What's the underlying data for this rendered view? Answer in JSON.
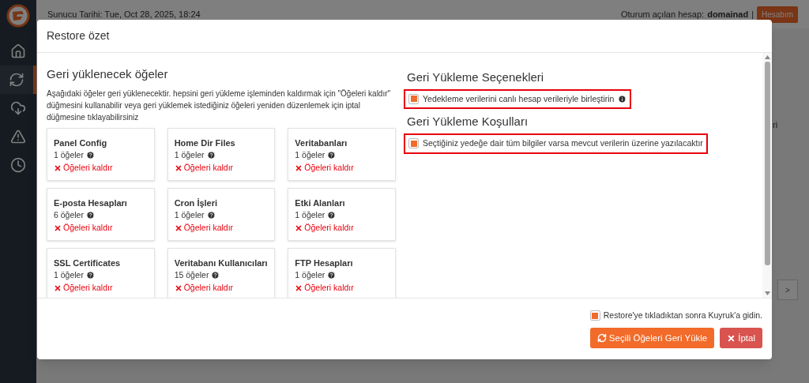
{
  "header": {
    "date_label": "Sunucu Tarihi: Tue, Oct 28, 2025, 18:24",
    "login_label": "Oturum açılan hesap:",
    "username": "domainad",
    "separator": "|",
    "account_button": "Hesabım"
  },
  "sidebar": {
    "items": [
      {
        "kind": "home",
        "selected": false
      },
      {
        "kind": "refresh",
        "selected": true
      },
      {
        "kind": "download",
        "selected": false
      },
      {
        "kind": "warning",
        "selected": false
      },
      {
        "kind": "clock",
        "selected": false
      }
    ]
  },
  "background_fragments": [
    "ri",
    ">"
  ],
  "modal": {
    "title": "Restore özet",
    "items_heading": "Geri yüklenecek öğeler",
    "description": "Aşağıdaki öğeler geri yüklenecektir. hepsini geri yükleme işleminden kaldırmak için \"Öğeleri kaldır\" düğmesini kullanabilir veya geri yüklemek istediğiniz öğeleri yeniden düzenlemek için iptal düğmesine tıklayabilirsiniz",
    "items": [
      {
        "name": "Panel Config",
        "count": "1 öğeler",
        "remove": "Öğeleri kaldır"
      },
      {
        "name": "Home Dir Files",
        "count": "1 öğeler",
        "remove": "Öğeleri kaldır"
      },
      {
        "name": "Veritabanları",
        "count": "1 öğeler",
        "remove": "Öğeleri kaldır"
      },
      {
        "name": "E-posta Hesapları",
        "count": "6 öğeler",
        "remove": "Öğeleri kaldır"
      },
      {
        "name": "Cron İşleri",
        "count": "1 öğeler",
        "remove": "Öğeleri kaldır"
      },
      {
        "name": "Etki Alanları",
        "count": "1 öğeler",
        "remove": "Öğeleri kaldır"
      },
      {
        "name": "SSL Certificates",
        "count": "1 öğeler",
        "remove": "Öğeleri kaldır"
      },
      {
        "name": "Veritabanı Kullanıcıları",
        "count": "15 öğeler",
        "remove": "Öğeleri kaldır"
      },
      {
        "name": "FTP Hesapları",
        "count": "1 öğeler",
        "remove": "Öğeleri kaldır"
      }
    ],
    "options_heading": "Geri Yükleme Seçenekleri",
    "options": [
      {
        "label": "Yedekleme verilerini canlı hesap verileriyle birleştirin",
        "checked": true,
        "highlighted": true,
        "info": true
      }
    ],
    "conditions_heading": "Geri Yükleme Koşulları",
    "conditions": [
      {
        "label": "Seçtiğiniz yedeğe dair tüm bilgiler varsa mevcut verilerin üzerine yazılacaktır",
        "checked": true,
        "highlighted": true,
        "info": false
      }
    ],
    "queue_checkbox": {
      "label": "Restore'ye tıkladıktan sonra Kuyruk'a gidin.",
      "checked": true
    },
    "restore_button": "Seçili Öğeleri Geri Yükle",
    "cancel_button": "İptal"
  }
}
